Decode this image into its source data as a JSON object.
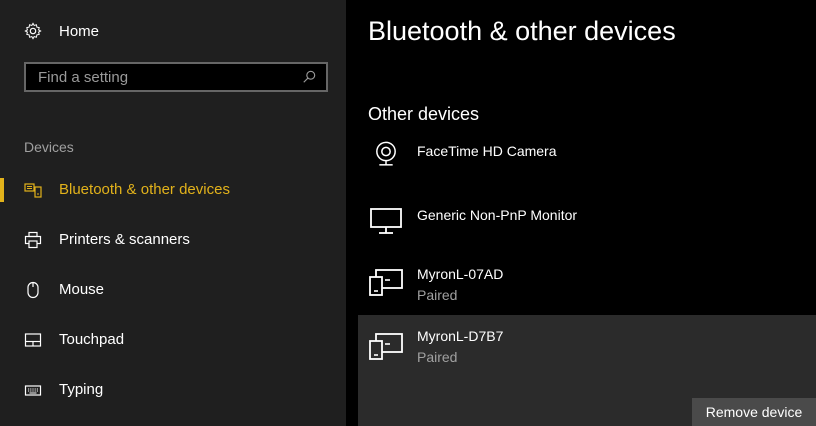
{
  "sidebar": {
    "home_label": "Home",
    "search_placeholder": "Find a setting",
    "section_title": "Devices",
    "items": [
      {
        "label": "Bluetooth & other devices",
        "icon": "bluetooth-devices-icon",
        "active": true
      },
      {
        "label": "Printers & scanners",
        "icon": "printer-icon",
        "active": false
      },
      {
        "label": "Mouse",
        "icon": "mouse-icon",
        "active": false
      },
      {
        "label": "Touchpad",
        "icon": "touchpad-icon",
        "active": false
      },
      {
        "label": "Typing",
        "icon": "keyboard-icon",
        "active": false
      }
    ]
  },
  "main": {
    "title": "Bluetooth & other devices",
    "group_title": "Other devices",
    "devices": [
      {
        "name": "FaceTime HD Camera",
        "status": "",
        "icon": "webcam-icon"
      },
      {
        "name": "Generic Non-PnP Monitor",
        "status": "",
        "icon": "monitor-icon"
      },
      {
        "name": "MyronL-07AD",
        "status": "Paired",
        "icon": "device-icon"
      },
      {
        "name": "MyronL-D7B7",
        "status": "Paired",
        "icon": "device-icon",
        "selected": true
      }
    ],
    "remove_button": "Remove device"
  },
  "colors": {
    "accent": "#e2b21b",
    "sidebar_bg": "#1f1f1f",
    "main_bg": "#000000",
    "selected_bg": "#2b2b2b",
    "button_bg": "#4a4a4a"
  }
}
